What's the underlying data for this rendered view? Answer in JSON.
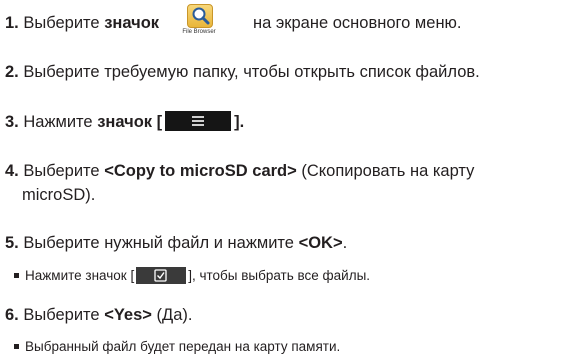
{
  "steps": [
    {
      "num": "1.",
      "pre": "Выберите ",
      "bold": "значок",
      "post": "на экране основного меню.",
      "icon_caption": "File Browser",
      "icon": "file-browser-icon"
    },
    {
      "num": "2.",
      "text": "Выберите требуемую папку, чтобы открыть список файлов."
    },
    {
      "num": "3.",
      "pre": "Нажмите ",
      "bold": "значок [",
      "post": "].",
      "icon": "menu-icon"
    },
    {
      "num": "4.",
      "pre": "Выберите ",
      "bold": "<Copy to microSD card>",
      "post": " (Скопировать на карту",
      "line2": "microSD)."
    },
    {
      "num": "5.",
      "pre": "Выберите нужный файл и нажмите ",
      "bold": "<OK>",
      "post": "."
    },
    {
      "num": "6.",
      "pre": "Выберите ",
      "bold": "<Yes>",
      "post": " (Да)."
    }
  ],
  "subs": [
    {
      "pre": "Нажмите значок [",
      "post": "], чтобы выбрать все файлы.",
      "icon": "checkbox-icon"
    },
    {
      "text": "Выбранный файл будет передан на карту памяти."
    }
  ],
  "colors": {
    "text": "#231f20",
    "button_bg": "#151515",
    "icon_tile": "#e9b63a"
  }
}
